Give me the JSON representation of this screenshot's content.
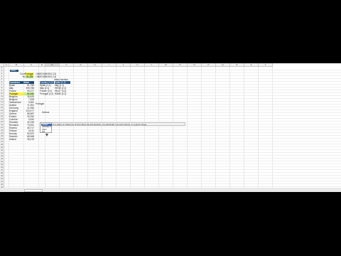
{
  "columns": [
    "A",
    "B",
    "C",
    "D",
    "E",
    "F",
    "G",
    "H",
    "I",
    "J",
    "K",
    "L",
    "M",
    "N",
    "O",
    "P",
    "Q",
    "R",
    "S",
    "T"
  ],
  "selected_column": "E",
  "rows": [
    "1",
    "2",
    "3",
    "4",
    "5",
    "6",
    "7",
    "8",
    "9",
    "10",
    "11",
    "12",
    "13",
    "14",
    "15",
    "16",
    "17",
    "18",
    "19",
    "20",
    "21",
    "22",
    "23",
    "24",
    "25",
    "26",
    "27",
    "28",
    "29",
    "30",
    "31",
    "32",
    "33",
    "34",
    "35",
    "36",
    "37",
    "38",
    "39",
    "40",
    "41",
    "42",
    "43",
    "44",
    "45"
  ],
  "name_box": "INDEX",
  "lookup": {
    "country_label": "Country",
    "country_value": "Portugal",
    "year_label": "Year",
    "year_value": "80,480",
    "formula_1": "=INDEX(B6:B31,C3)",
    "formula_2": "=INDEX(B6:B31,C4)"
  },
  "table_headers": {
    "country": "Countries",
    "sales": "Sales"
  },
  "countries": [
    {
      "name": "Spain",
      "sales": "81,786"
    },
    {
      "name": "Italy",
      "sales": "495,786"
    },
    {
      "name": "France",
      "sales": "95,127"
    },
    {
      "name": "Portugal",
      "sales": "80,480"
    },
    {
      "name": "Belgium",
      "sales": "35,625"
    },
    {
      "name": "Belgium",
      "sales": "7,628"
    },
    {
      "name": "Switzerland",
      "sales": "9,981"
    },
    {
      "name": "Austria",
      "sales": "71,951"
    },
    {
      "name": "Germany",
      "sales": "21,995"
    },
    {
      "name": "England",
      "sales": "103,477"
    },
    {
      "name": "Greece",
      "sales": "85,687"
    },
    {
      "name": "Poland",
      "sales": "25,260"
    },
    {
      "name": "Czechia",
      "sales": "5,490"
    },
    {
      "name": "Slovakia",
      "sales": "42,196"
    },
    {
      "name": "Romania",
      "sales": "73,091"
    },
    {
      "name": "Estonia",
      "sales": "46,717"
    },
    {
      "name": "Finland",
      "sales": "6,410"
    },
    {
      "name": "Norway",
      "sales": "50,870"
    },
    {
      "name": "Sweden",
      "sales": "68,968"
    },
    {
      "name": "Ireland",
      "sales": "35,478"
    }
  ],
  "notes": {
    "n1": "Portugal",
    "n2": "Greece"
  },
  "index_table": {
    "title": "Index function",
    "col1": "Country (1,2)",
    "col2": "Sales (1,2)",
    "rows": [
      {
        "a": "Spain (1,1)",
        "b": "Italy (1,1)"
      },
      {
        "a": "Italy (2,1)",
        "b": "98765 (2,2)"
      },
      {
        "a": "France (3,1)",
        "b": "95127 (3,2)"
      },
      {
        "a": "Portugal (4,1)",
        "b": "80480 (4,2)"
      }
    ]
  },
  "editing_cell": "=INDEX(",
  "tooltip": "Returns a value or reference of the cell at the intersection of a particular row and column, in a given range",
  "autocomplete": [
    "INDEX",
    "INDIRECT",
    "INFO",
    "INT"
  ]
}
